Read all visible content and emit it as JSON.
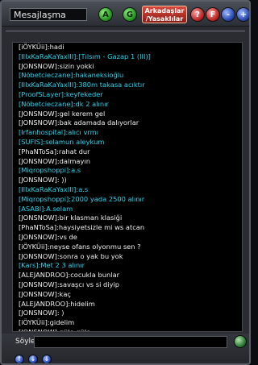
{
  "window": {
    "title": "Mesajlaşma"
  },
  "toolbar": {
    "btn_a_label": "A",
    "btn_g_label": "G",
    "friends_label": "Arkadaşlar /Yasaklılar",
    "help_label": "?",
    "f_label": "F",
    "minus_label": "-",
    "plus_label": "+"
  },
  "colors": {
    "cyan_text": "#22d6ee",
    "white_text": "#f0f0f0",
    "friends_button": "#c0392b"
  },
  "messages": [
    {
      "text": "[iÖYKÜii]:hadi",
      "color": "white"
    },
    {
      "text": "[IIIxKaRaKaYaxIII]:[Tılsım - Gazap 1 (III)]",
      "color": "cyan"
    },
    {
      "text": "[JONSNOW]:sizin yokki",
      "color": "white"
    },
    {
      "text": "[Nöbetcieczane]:hakaneksioğlu",
      "color": "cyan"
    },
    {
      "text": "[IIIxKaRaKaYaxIII]:380m takasa acıktır",
      "color": "cyan"
    },
    {
      "text": "[ProofSLayer]:keyfekeder",
      "color": "cyan"
    },
    {
      "text": "[Nöbetcieczane]:dk 2 alınır",
      "color": "cyan"
    },
    {
      "text": "[JONSNOW]:gel kerem gel",
      "color": "white"
    },
    {
      "text": "[JONSNOW]:bak adamada dalıyorlar",
      "color": "white"
    },
    {
      "text": "[Irfanhospital]:alıcı vrmı",
      "color": "cyan"
    },
    {
      "text": "[SUFIS]:selamun aleykum",
      "color": "cyan"
    },
    {
      "text": "[PhaNToSa]:rahat dur",
      "color": "white"
    },
    {
      "text": "[JONSNOW]:dalmayın",
      "color": "white"
    },
    {
      "text": "[Miqropshoppi]:a.s",
      "color": "cyan"
    },
    {
      "text": "[JONSNOW]: ))",
      "color": "white"
    },
    {
      "text": "[IIIxKaRaKaYaxIII]:a.s",
      "color": "cyan"
    },
    {
      "text": "[Miqropshoppi]:2000 yada 2500 alınır",
      "color": "cyan"
    },
    {
      "text": "[ASABI]:A.selam",
      "color": "cyan"
    },
    {
      "text": "[JONSNOW]:bir klasman klasiği",
      "color": "white"
    },
    {
      "text": "[PhaNToSa]:haysiyetsizle mi ws atcan",
      "color": "white"
    },
    {
      "text": "[JONSNOW]:vs de",
      "color": "white"
    },
    {
      "text": "[iÖYKÜii]:neyse ofans olyonmu sen ?",
      "color": "white"
    },
    {
      "text": "[JONSNOW]:sonra o yak bu yok",
      "color": "white"
    },
    {
      "text": "[Kars]:Met 2 3 alınır",
      "color": "cyan"
    },
    {
      "text": "[ALEJANDROO]:cocukla bunlar",
      "color": "white"
    },
    {
      "text": "[JONSNOW]:savaşcı vs si diyip",
      "color": "white"
    },
    {
      "text": "[JONSNOW]:kaç",
      "color": "white"
    },
    {
      "text": "[ALEJANDROO]:hidelim",
      "color": "white"
    },
    {
      "text": "[JONSNOW]: )",
      "color": "white"
    },
    {
      "text": "[iÖYKÜii]:gidelim",
      "color": "white"
    },
    {
      "text": "[JONSNOW]:güle güle",
      "color": "white"
    }
  ],
  "input": {
    "label": "Söyle:",
    "value": ""
  },
  "nav": {
    "up_label": "↑",
    "down_label": "↓",
    "bottom_label": "⇓"
  }
}
